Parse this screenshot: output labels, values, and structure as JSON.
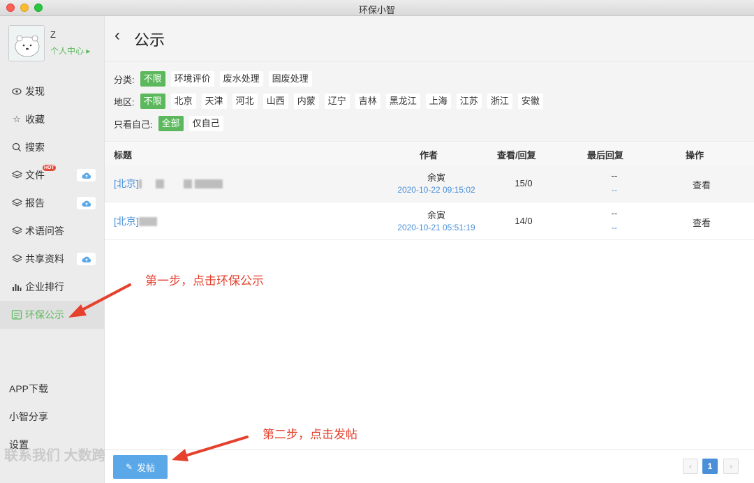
{
  "window": {
    "title": "环保小智"
  },
  "sidebar": {
    "username": "Z",
    "profile_link": "个人中心 ▸",
    "items": [
      {
        "label": "发现",
        "icon": "eye-icon"
      },
      {
        "label": "收藏",
        "icon": "star-icon"
      },
      {
        "label": "搜索",
        "icon": "search-icon"
      },
      {
        "label": "文件",
        "icon": "layers-icon",
        "badge": "HOT",
        "upload": true
      },
      {
        "label": "报告",
        "icon": "layers-icon",
        "upload": true
      },
      {
        "label": "术语问答",
        "icon": "layers-icon"
      },
      {
        "label": "共享资料",
        "icon": "layers-icon",
        "upload": true
      },
      {
        "label": "企业排行",
        "icon": "bar-chart-icon"
      },
      {
        "label": "环保公示",
        "icon": "notice-icon",
        "active": true
      }
    ],
    "bottom": [
      "APP下载",
      "小智分享",
      "设置"
    ],
    "watermark": "联系我们  大数跨境"
  },
  "header": {
    "title": "公示"
  },
  "filters": {
    "category": {
      "label": "分类:",
      "options": [
        "不限",
        "环境评价",
        "废水处理",
        "固废处理"
      ],
      "selected": 0
    },
    "region": {
      "label": "地区:",
      "options": [
        "不限",
        "北京",
        "天津",
        "河北",
        "山西",
        "内蒙",
        "辽宁",
        "吉林",
        "黑龙江",
        "上海",
        "江苏",
        "浙江",
        "安徽"
      ],
      "selected": 0
    },
    "mine": {
      "label": "只看自己:",
      "options": [
        "全部",
        "仅自己"
      ],
      "selected": 0
    }
  },
  "table": {
    "columns": [
      "标题",
      "作者",
      "查看/回复",
      "最后回复",
      "操作"
    ],
    "rows": [
      {
        "title": "[北京]",
        "author": "余寅",
        "date": "2020-10-22 09:15:02",
        "views": "15/0",
        "last_reply": "--",
        "last_reply_date": "--",
        "action": "查看"
      },
      {
        "title": "[北京]",
        "author": "余寅",
        "date": "2020-10-21 05:51:19",
        "views": "14/0",
        "last_reply": "--",
        "last_reply_date": "--",
        "action": "查看"
      }
    ]
  },
  "footer": {
    "post_label": "发帖",
    "current_page": "1",
    "prev": "‹",
    "next": "›"
  },
  "annotations": {
    "step1": "第一步，点击环保公示",
    "step2": "第二步，点击发帖"
  },
  "colors": {
    "accent_green": "#5cb85c",
    "link_blue": "#4a90d9",
    "button_blue": "#5ba8e8",
    "annotation_red": "#e5412d"
  }
}
